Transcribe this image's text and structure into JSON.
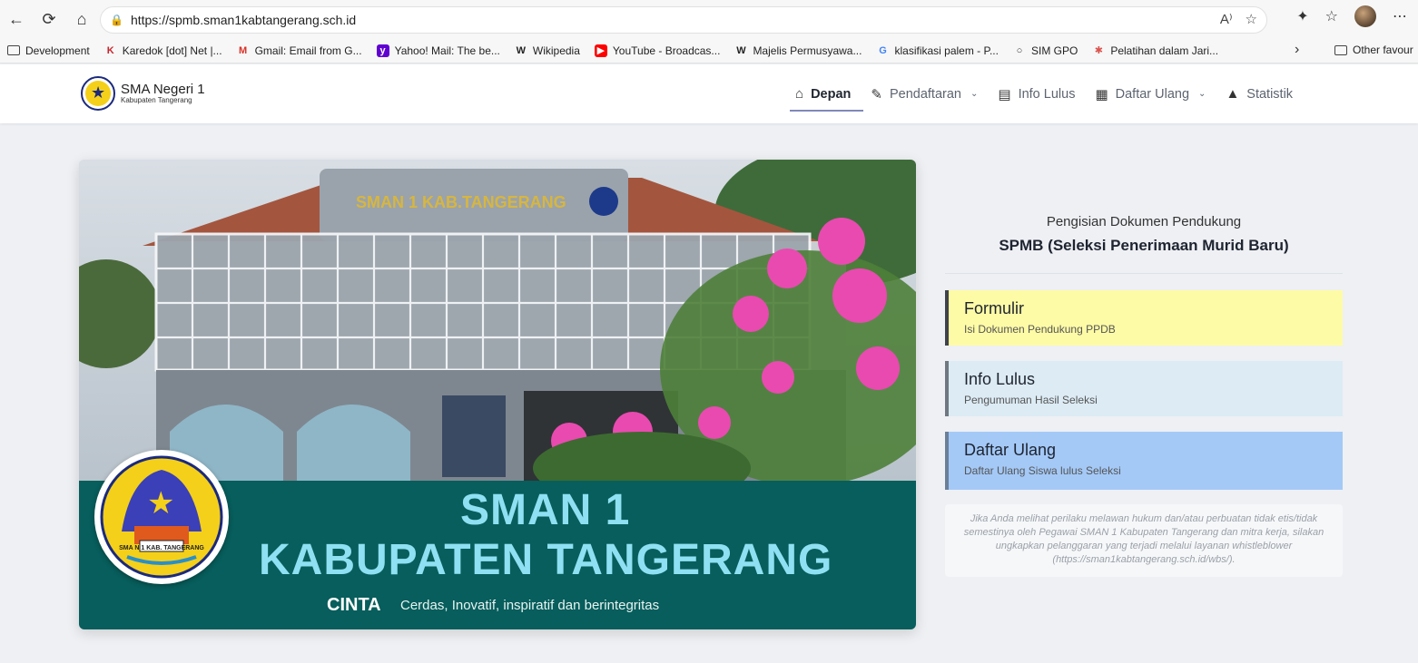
{
  "browser": {
    "url": "https://spmb.sman1kabtangerang.sch.id",
    "bookmarks": [
      {
        "label": "Development",
        "icon": "folder-icon"
      },
      {
        "label": "Karedok [dot] Net |...",
        "icon": "karedok-icon"
      },
      {
        "label": "Gmail: Email from G...",
        "icon": "gmail-icon"
      },
      {
        "label": "Yahoo! Mail: The be...",
        "icon": "yahoo-icon"
      },
      {
        "label": "Wikipedia",
        "icon": "wikipedia-icon"
      },
      {
        "label": "YouTube - Broadcas...",
        "icon": "youtube-icon"
      },
      {
        "label": "Majelis Permusyawa...",
        "icon": "wikipedia-icon"
      },
      {
        "label": "klasifikasi palem - P...",
        "icon": "google-icon"
      },
      {
        "label": "SIM GPO",
        "icon": "globe-icon"
      },
      {
        "label": "Pelatihan dalam Jari...",
        "icon": "pelatihan-icon"
      }
    ],
    "other_favourites": "Other favour"
  },
  "site": {
    "brand_name": "SMA Negeri 1",
    "brand_sub": "Kabupaten Tangerang",
    "nav": [
      {
        "label": "Depan",
        "icon": "home-icon"
      },
      {
        "label": "Pendaftaran",
        "icon": "edit-icon"
      },
      {
        "label": "Info Lulus",
        "icon": "list-icon"
      },
      {
        "label": "Daftar Ulang",
        "icon": "id-card-icon"
      },
      {
        "label": "Statistik",
        "icon": "chart-area-icon"
      }
    ]
  },
  "hero": {
    "building_sign": "SMAN 1 KAB.TANGERANG",
    "seal_text": "SMA N 1 KAB. TANGERANG",
    "title_line1": "SMAN 1",
    "title_line2": "KABUPATEN TANGERANG",
    "cinta": "CINTA",
    "tagline": "Cerdas, Inovatif, inspiratif dan berintegritas"
  },
  "panel": {
    "subtitle": "Pengisian Dokumen Pendukung",
    "title": "SPMB (Seleksi Penerimaan Murid Baru)",
    "cards": [
      {
        "title": "Formulir",
        "desc": "Isi Dokumen Pendukung PPDB",
        "bg": "#fefba6",
        "border": "#3f4248"
      },
      {
        "title": "Info Lulus",
        "desc": "Pengumuman Hasil Seleksi",
        "bg": "#dcebf4",
        "border": "#6f7780"
      },
      {
        "title": "Daftar Ulang",
        "desc": "Daftar Ulang Siswa lulus Seleksi",
        "bg": "#a4c9f7",
        "border": "#6b7f99"
      }
    ],
    "note": "Jika Anda melihat perilaku melawan hukum dan/atau perbuatan tidak etis/tidak semestinya oleh Pegawai SMAN 1 Kabupaten Tangerang dan mitra kerja, silakan ungkapkan pelanggaran yang terjadi melalui layanan whistleblower (https://sman1kabtangerang.sch.id/wbs/)."
  }
}
